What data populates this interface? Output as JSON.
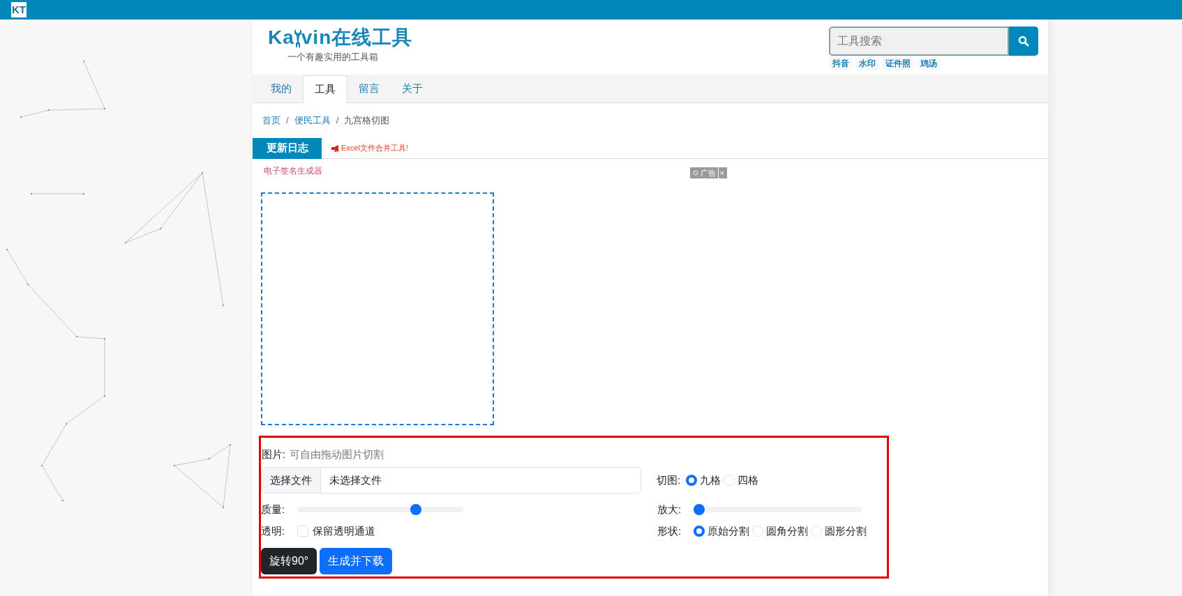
{
  "topbar": {
    "logo": "KT"
  },
  "header": {
    "logo_before": "Ka",
    "logo_after": "vin在线工具",
    "slogan": "一个有趣实用的工具箱",
    "search": {
      "placeholder": "工具搜索"
    },
    "hot_tags": [
      "抖音",
      "水印",
      "证件照",
      "鸡汤"
    ]
  },
  "tabs": [
    {
      "label": "我的",
      "selected": false
    },
    {
      "label": "工具",
      "selected": true
    },
    {
      "label": "留言",
      "selected": false
    },
    {
      "label": "关于",
      "selected": false
    }
  ],
  "breadcrumb": [
    {
      "label": "首页",
      "kind": "link"
    },
    {
      "label": "便民工具",
      "kind": "link"
    },
    {
      "label": "九宫格切图",
      "kind": "current"
    }
  ],
  "breadcrumb_separator": "/",
  "update_log": {
    "title": "更新日志",
    "news": "Excel文件合并工具!"
  },
  "promo_link": "电子签名生成器",
  "ad": {
    "label": "广告",
    "close": "×"
  },
  "form": {
    "image_label": "图片:",
    "image_hint": "可自由拖动图片切割",
    "file_button": "选择文件",
    "file_value": "未选择文件",
    "cut_label": "切图:",
    "cut_options": [
      {
        "label": "九格",
        "selected": true
      },
      {
        "label": "四格",
        "selected": false
      }
    ],
    "quality_label": "质量:",
    "quality": {
      "level": 0.73
    },
    "zoom_label": "放大:",
    "zoom": {
      "level": 0
    },
    "transparent_label": "透明:",
    "transparent": {
      "label": "保留透明通道",
      "checked": false
    },
    "shape_label": "形状:",
    "shape_options": [
      {
        "label": "原始分割",
        "selected": true
      },
      {
        "label": "圆角分割",
        "selected": false
      },
      {
        "label": "圆形分割",
        "selected": false
      }
    ],
    "buttons": [
      {
        "label": "旋转90°",
        "kind": "dark"
      },
      {
        "label": "生成并下载",
        "kind": "primary"
      }
    ]
  }
}
